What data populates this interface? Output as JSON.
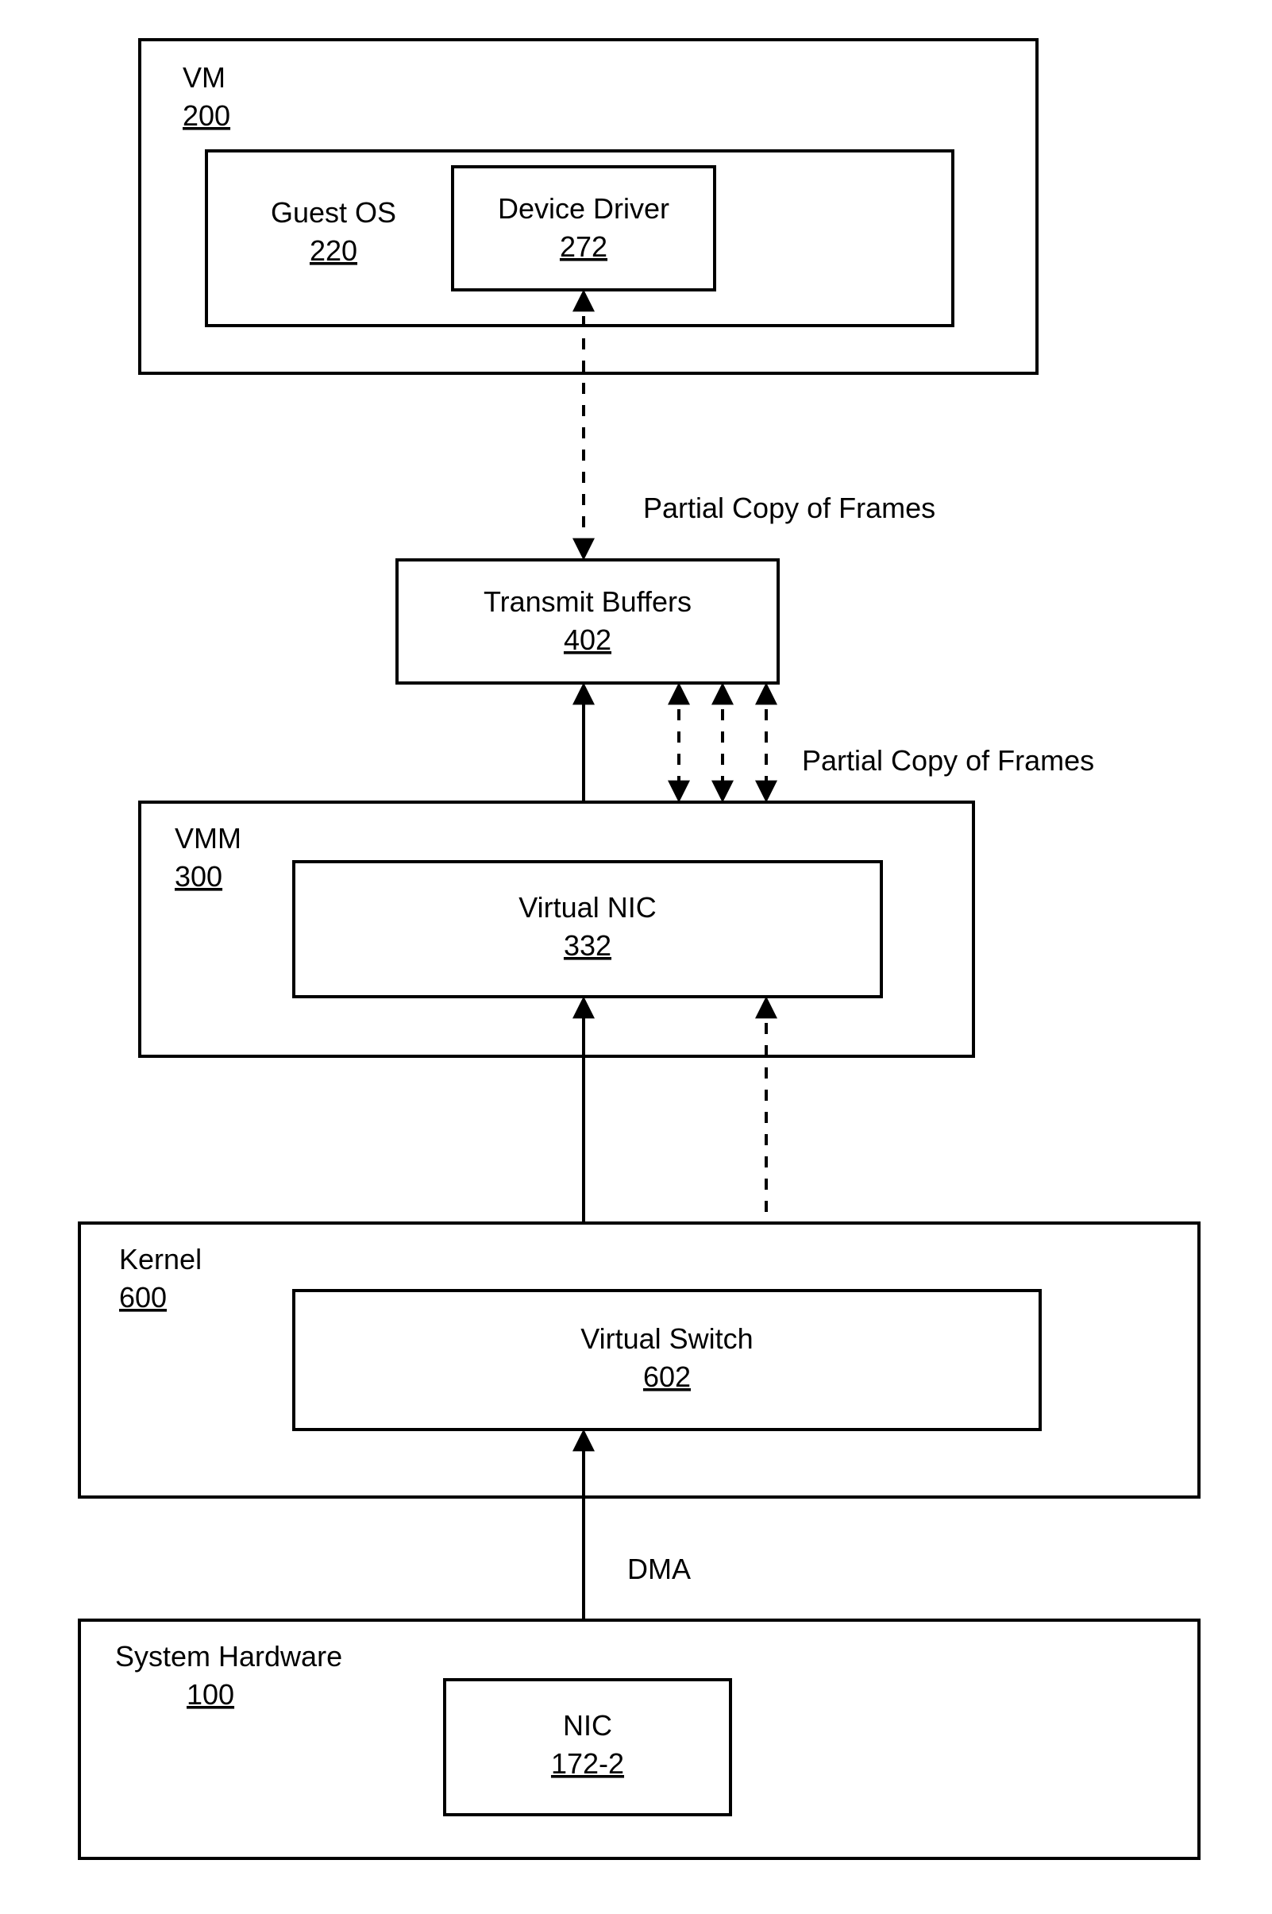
{
  "diagram": {
    "vm": {
      "title": "VM",
      "ref": "200"
    },
    "guest_os": {
      "title": "Guest OS",
      "ref": "220"
    },
    "device_driver": {
      "title": "Device Driver",
      "ref": "272"
    },
    "transmit_buffers": {
      "title": "Transmit Buffers",
      "ref": "402"
    },
    "vmm": {
      "title": "VMM",
      "ref": "300"
    },
    "virtual_nic": {
      "title": "Virtual NIC",
      "ref": "332"
    },
    "kernel": {
      "title": "Kernel",
      "ref": "600"
    },
    "virtual_switch": {
      "title": "Virtual Switch",
      "ref": "602"
    },
    "system_hardware": {
      "title": "System Hardware",
      "ref": "100"
    },
    "nic": {
      "title": "NIC",
      "ref": "172-2"
    },
    "labels": {
      "partial_copy_1": "Partial Copy of Frames",
      "partial_copy_2": "Partial Copy of Frames",
      "dma": "DMA"
    }
  }
}
